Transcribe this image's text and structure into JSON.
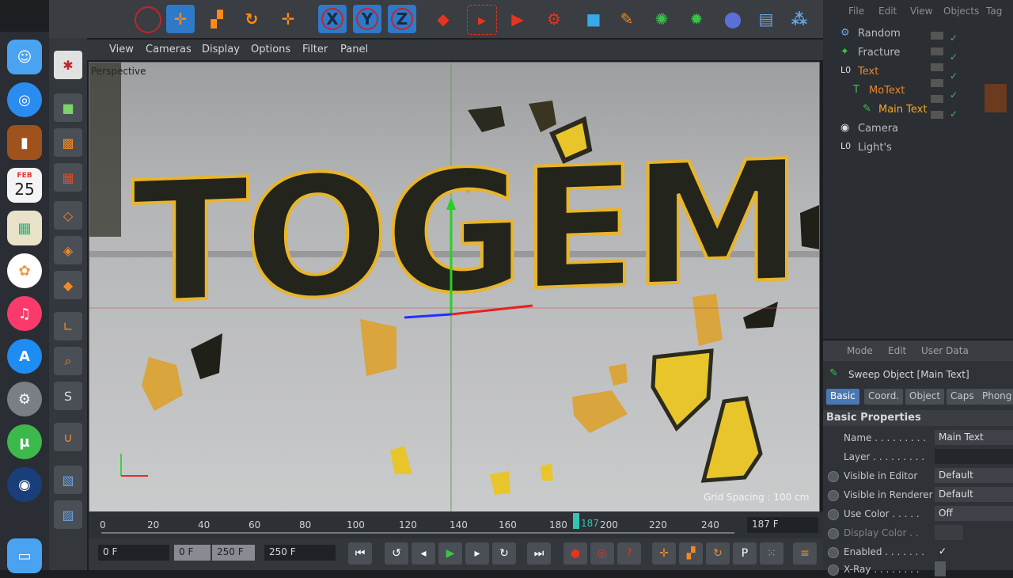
{
  "dock": {
    "calendar_month": "FEB",
    "calendar_day": "25"
  },
  "viewport_menu": {
    "view": "View",
    "cameras": "Cameras",
    "display": "Display",
    "options": "Options",
    "filter": "Filter",
    "panel": "Panel"
  },
  "viewport": {
    "label": "Perspective",
    "grid_spacing": "Grid Spacing : 100 cm",
    "scene_text": "TOGEM"
  },
  "toolbar": {
    "x": "X",
    "y": "Y",
    "z": "Z"
  },
  "object_manager": {
    "menu": [
      "File",
      "Edit",
      "View",
      "Objects",
      "Tag"
    ],
    "objects": [
      {
        "name": "Random",
        "color": "#b8bcc2"
      },
      {
        "name": "Fracture",
        "color": "#b8bcc2"
      },
      {
        "name": "Text",
        "color": "#e8862a"
      },
      {
        "name": "MoText",
        "color": "#e8862a"
      },
      {
        "name": "Main Text",
        "color": "#f5a623"
      },
      {
        "name": "Camera",
        "color": "#b8bcc2"
      },
      {
        "name": "Light's",
        "color": "#b8bcc2"
      }
    ]
  },
  "attribute_manager": {
    "menu": [
      "Mode",
      "Edit",
      "User Data"
    ],
    "title": "Sweep Object [Main Text]",
    "tabs": [
      "Basic",
      "Coord.",
      "Object",
      "Caps",
      "Phong"
    ],
    "section": "Basic Properties",
    "props": [
      {
        "label": "Name . . . . . . . . .",
        "value": "Main Text"
      },
      {
        "label": "Layer . . . . . . . . .",
        "value": ""
      },
      {
        "label": "Visible in Editor",
        "value": "Default"
      },
      {
        "label": "Visible in Renderer",
        "value": "Default"
      },
      {
        "label": "Use Color . . . . .",
        "value": "Off"
      },
      {
        "label": "Display Color . .",
        "value": ""
      },
      {
        "label": "Enabled . . . . . . .",
        "value": "✓"
      },
      {
        "label": "X-Ray . . . . . . . .",
        "value": ""
      }
    ]
  },
  "timeline": {
    "ticks": [
      "0",
      "20",
      "40",
      "60",
      "80",
      "100",
      "120",
      "140",
      "160",
      "180",
      "200",
      "220",
      "240"
    ],
    "current_marker": "187",
    "current_field": "187 F"
  },
  "transport": {
    "start": "0 F",
    "range_start": "0 F",
    "range_end": "250 F",
    "end": "250 F"
  }
}
